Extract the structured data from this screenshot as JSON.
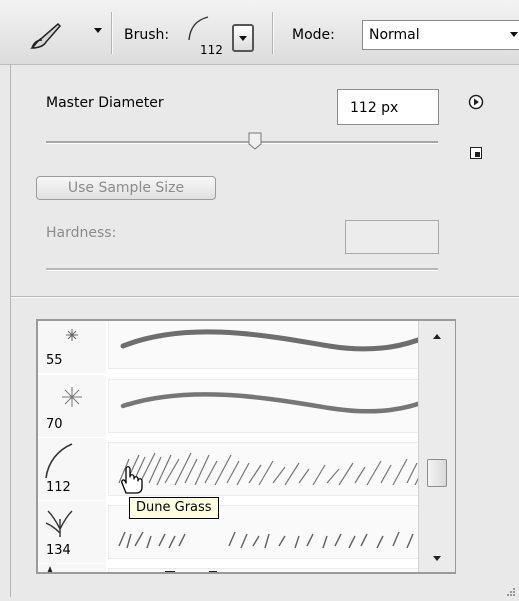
{
  "toolbar": {
    "tool_icon": "brush-tool-icon",
    "brush_label": "Brush:",
    "brush_size": "112",
    "mode_label": "Mode:",
    "mode_value": "Normal"
  },
  "panel": {
    "master_diameter_label": "Master Diameter",
    "master_diameter_value": "112 px",
    "use_sample_size_label": "Use Sample Size",
    "hardness_label": "Hardness:",
    "hardness_value": ""
  },
  "brushes": [
    {
      "size": "55",
      "icon": "star-brush-icon"
    },
    {
      "size": "70",
      "icon": "star-brush-icon"
    },
    {
      "size": "112",
      "icon": "curve-brush-icon",
      "selected": true
    },
    {
      "size": "134",
      "icon": "grass-brush-icon"
    },
    {
      "size": "",
      "icon": "scattered-brush-icon"
    }
  ],
  "tooltip": "Dune Grass",
  "colors": {
    "accent": "#000000",
    "tooltip_bg": "#ffffe1",
    "panel_bg": "#e9e9e9"
  }
}
